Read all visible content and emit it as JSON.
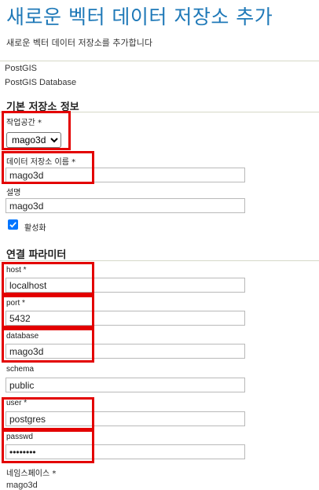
{
  "header": {
    "title": "새로운 벡터 데이터 저장소 추가",
    "subtitle": "새로운 벡터 데이터 저장소를 추가합니다"
  },
  "store": {
    "type": "PostGIS",
    "description": "PostGIS Database"
  },
  "basic_info": {
    "section_title": "기본 저장소 정보",
    "workspace_label": "작업공간 *",
    "workspace_selected": "mago3d",
    "name_label": "데이터 저장소 이름 *",
    "name_value": "mago3d",
    "description_label": "설명",
    "description_value": "mago3d",
    "enabled_label": "활성화",
    "enabled": true
  },
  "connection": {
    "section_title": "연결 파라미터",
    "host_label": "host *",
    "host_value": "localhost",
    "port_label": "port *",
    "port_value": "5432",
    "database_label": "database",
    "database_value": "mago3d",
    "schema_label": "schema",
    "schema_value": "public",
    "user_label": "user *",
    "user_value": "postgres",
    "passwd_label": "passwd",
    "passwd_value": "postgres",
    "namespace_label": "네임스페이스 *",
    "namespace_value": "mago3d"
  },
  "colors": {
    "title": "#1f79b8",
    "highlight": "#e30000",
    "checkbox": "#0075ff"
  }
}
